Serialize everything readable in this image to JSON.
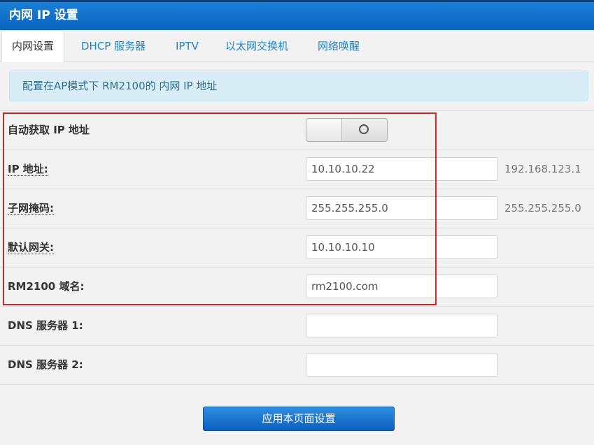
{
  "window": {
    "title": "内网 IP 设置"
  },
  "tabs": [
    {
      "label": "内网设置",
      "active": true
    },
    {
      "label": "DHCP 服务器"
    },
    {
      "label": "IPTV"
    },
    {
      "label": "以太网交换机"
    },
    {
      "label": "网络唤醒"
    }
  ],
  "info": {
    "text": "配置在AP模式下 RM2100的 内网 IP 地址"
  },
  "form": {
    "auto_ip": {
      "label": "自动获取 IP 地址",
      "state": "off"
    },
    "ip": {
      "label": "IP 地址:",
      "value": "10.10.10.22",
      "hint": "192.168.123.1"
    },
    "netmask": {
      "label": "子网掩码:",
      "value": "255.255.255.0",
      "hint": "255.255.255.0"
    },
    "gateway": {
      "label": "默认网关:",
      "value": "10.10.10.10"
    },
    "domain": {
      "label": "RM2100 域名:",
      "value": "rm2100.com"
    },
    "dns1": {
      "label": "DNS 服务器 1:",
      "value": ""
    },
    "dns2": {
      "label": "DNS 服务器 2:",
      "value": ""
    }
  },
  "actions": {
    "apply_label": "应用本页面设置"
  },
  "colors": {
    "accent": "#0a64bf",
    "highlight_border": "#e02020",
    "info_bg": "#d9edf7",
    "tab_link": "#1a86c8"
  }
}
